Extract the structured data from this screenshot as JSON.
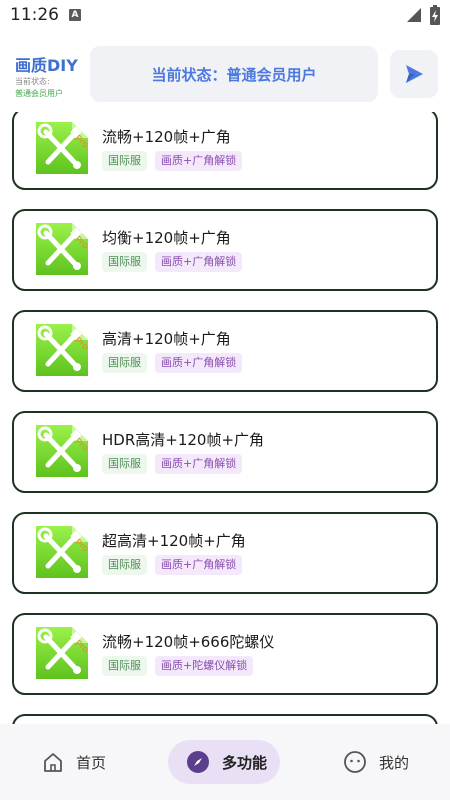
{
  "status_bar": {
    "time": "11:26",
    "notification_glyph": "A"
  },
  "header": {
    "app_title": "画质DIY",
    "status_label": "当前状态:",
    "status_value": "普通会员用户",
    "status_banner": "当前状态：普通会员用户",
    "send_icon": "send-icon"
  },
  "cards": [
    {
      "title": "流畅+120帧+广角",
      "server_tag": "国际服",
      "unlock_tag": "画质+广角解锁"
    },
    {
      "title": "均衡+120帧+广角",
      "server_tag": "国际服",
      "unlock_tag": "画质+广角解锁"
    },
    {
      "title": "高清+120帧+广角",
      "server_tag": "国际服",
      "unlock_tag": "画质+广角解锁"
    },
    {
      "title": "HDR高清+120帧+广角",
      "server_tag": "国际服",
      "unlock_tag": "画质+广角解锁"
    },
    {
      "title": "超高清+120帧+广角",
      "server_tag": "国际服",
      "unlock_tag": "画质+广角解锁"
    },
    {
      "title": "流畅+120帧+666陀螺仪",
      "server_tag": "国际服",
      "unlock_tag": "画质+陀螺仪解锁"
    }
  ],
  "card_icon_badge": "Pro",
  "bottom_nav": {
    "items": [
      {
        "label": "首页",
        "icon": "home-icon"
      },
      {
        "label": "多功能",
        "icon": "compass-icon",
        "active": true
      },
      {
        "label": "我的",
        "icon": "smiley-icon"
      }
    ]
  },
  "colors": {
    "accent_blue": "#4c79e0",
    "active_tab_bg": "#e9e0f5",
    "card_border": "#1f3322",
    "icon_green": "#7fe03c"
  }
}
